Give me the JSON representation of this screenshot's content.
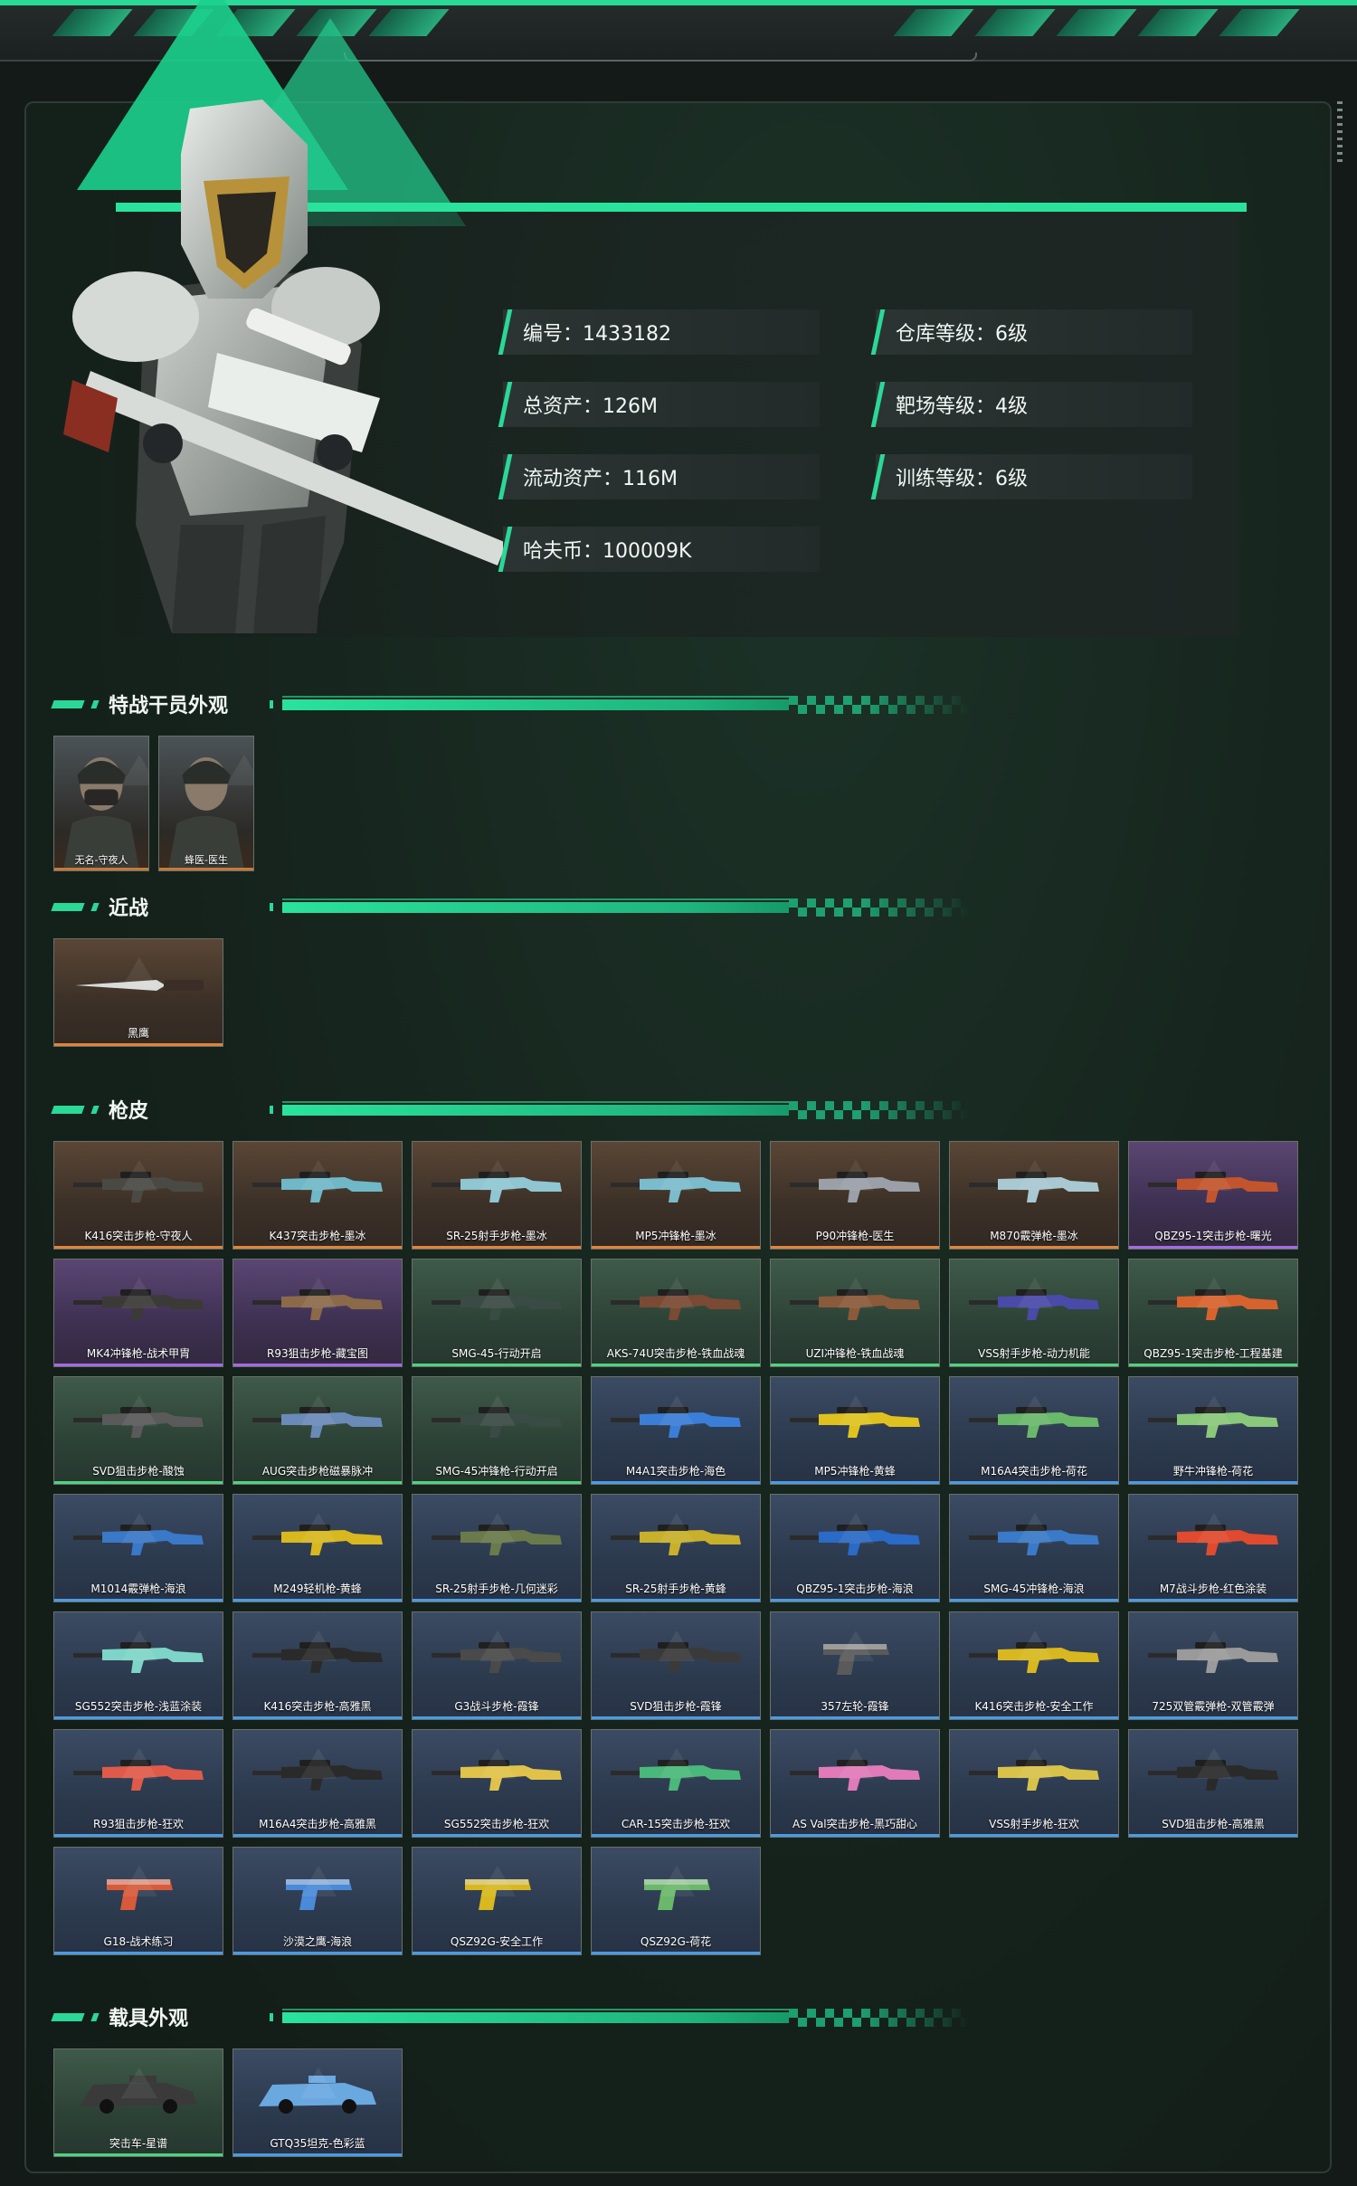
{
  "profile": {
    "info": [
      {
        "label": "编号：1433182"
      },
      {
        "label": "仓库等级：6级"
      },
      {
        "label": "总资产：126M"
      },
      {
        "label": "靶场等级：4级"
      },
      {
        "label": "流动资产：116M"
      },
      {
        "label": "训练等级：6级"
      },
      {
        "label": "哈夫币：100009K"
      }
    ]
  },
  "sections": {
    "operators": {
      "title": "特战干员外观",
      "items": [
        {
          "name": "无名-守夜人",
          "quality": "orange"
        },
        {
          "name": "蜂医-医生",
          "quality": "orange"
        }
      ]
    },
    "melee": {
      "title": "近战",
      "items": [
        {
          "name": "黑鹰",
          "quality": "orange"
        }
      ]
    },
    "skins": {
      "title": "枪皮",
      "items": [
        {
          "name": "K416突击步枪-守夜人",
          "quality": "orange",
          "color": "#4a4a44"
        },
        {
          "name": "K437突击步枪-墨冰",
          "quality": "orange",
          "color": "#6fb8c8"
        },
        {
          "name": "SR-25射手步枪-墨冰",
          "quality": "orange",
          "color": "#8fc6d2"
        },
        {
          "name": "MP5冲锋枪-墨冰",
          "quality": "orange",
          "color": "#7bbccc"
        },
        {
          "name": "P90冲锋枪-医生",
          "quality": "orange",
          "color": "#9a9fa8"
        },
        {
          "name": "M870霰弹枪-墨冰",
          "quality": "orange",
          "color": "#a8c8d2"
        },
        {
          "name": "QBZ95-1突击步枪-曙光",
          "quality": "purple",
          "color": "#c2552e"
        },
        {
          "name": "MK4冲锋枪-战术甲胄",
          "quality": "purple",
          "color": "#3c3a36"
        },
        {
          "name": "R93狙击步枪-藏宝图",
          "quality": "purple",
          "color": "#8b6a4a"
        },
        {
          "name": "SMG-45-行动开启",
          "quality": "green",
          "color": "#3a4a44"
        },
        {
          "name": "AKS-74U突击步枪-铁血战魂",
          "quality": "green",
          "color": "#7a4a34"
        },
        {
          "name": "UZI冲锋枪-铁血战魂",
          "quality": "green",
          "color": "#8a5a3a"
        },
        {
          "name": "VSS射手步枪-动力机能",
          "quality": "green",
          "color": "#4a4aa8"
        },
        {
          "name": "QBZ95-1突击步枪-工程基建",
          "quality": "green",
          "color": "#d8622e"
        },
        {
          "name": "SVD狙击步枪-酸蚀",
          "quality": "green",
          "color": "#5a5a5a"
        },
        {
          "name": "AUG突击步枪磁暴脉冲",
          "quality": "green",
          "color": "#6a8ab8"
        },
        {
          "name": "SMG-45冲锋枪-行动开启",
          "quality": "green",
          "color": "#3a4a44"
        },
        {
          "name": "M4A1突击步枪-海色",
          "quality": "blue",
          "color": "#3a7ed8"
        },
        {
          "name": "MP5冲锋枪-黄蜂",
          "quality": "blue",
          "color": "#e0c21e"
        },
        {
          "name": "M16A4突击步枪-荷花",
          "quality": "blue",
          "color": "#6ab86a"
        },
        {
          "name": "野牛冲锋枪-荷花",
          "quality": "blue",
          "color": "#8ac87a"
        },
        {
          "name": "M1014霰弹枪-海浪",
          "quality": "blue",
          "color": "#3a78c8"
        },
        {
          "name": "M249轻机枪-黄蜂",
          "quality": "blue",
          "color": "#d8b81e"
        },
        {
          "name": "SR-25射手步枪-几何迷彩",
          "quality": "blue",
          "color": "#6a7a4a"
        },
        {
          "name": "SR-25射手步枪-黄蜂",
          "quality": "blue",
          "color": "#c8b02a"
        },
        {
          "name": "QBZ95-1突击步枪-海浪",
          "quality": "blue",
          "color": "#2a6ac8"
        },
        {
          "name": "SMG-45冲锋枪-海浪",
          "quality": "blue",
          "color": "#3a7ac8"
        },
        {
          "name": "M7战斗步枪-红色涂装",
          "quality": "blue",
          "color": "#e04a2e"
        },
        {
          "name": "SG552突击步枪-浅蓝涂装",
          "quality": "blue",
          "color": "#7ed4c8"
        },
        {
          "name": "K416突击步枪-高雅黑",
          "quality": "blue",
          "color": "#2a2a2a"
        },
        {
          "name": "G3战斗步枪-霞锋",
          "quality": "blue",
          "color": "#4a4a4a"
        },
        {
          "name": "SVD狙击步枪-霞锋",
          "quality": "blue",
          "color": "#3a3a3a"
        },
        {
          "name": "357左轮-霞锋",
          "quality": "blue",
          "color": "#5a5a5a"
        },
        {
          "name": "K416突击步枪-安全工作",
          "quality": "blue",
          "color": "#d8b81e"
        },
        {
          "name": "725双管霰弹枪-双管霰弹",
          "quality": "blue",
          "color": "#9a9a9a"
        },
        {
          "name": "R93狙击步枪-狂欢",
          "quality": "blue",
          "color": "#e05a4a"
        },
        {
          "name": "M16A4突击步枪-高雅黑",
          "quality": "blue",
          "color": "#2a2a2a"
        },
        {
          "name": "SG552突击步枪-狂欢",
          "quality": "blue",
          "color": "#e0c24a"
        },
        {
          "name": "CAR-15突击步枪-狂欢",
          "quality": "blue",
          "color": "#4ab87a"
        },
        {
          "name": "AS Val突击步枪-黑巧甜心",
          "quality": "blue",
          "color": "#e07ab8"
        },
        {
          "name": "VSS射手步枪-狂欢",
          "quality": "blue",
          "color": "#d8c24a"
        },
        {
          "name": "SVD狙击步枪-高雅黑",
          "quality": "blue",
          "color": "#2a2a2a"
        },
        {
          "name": "G18-战术练习",
          "quality": "blue",
          "color": "#d85a3a"
        },
        {
          "name": "沙漠之鹰-海浪",
          "quality": "blue",
          "color": "#4a8ad8"
        },
        {
          "name": "QSZ92G-安全工作",
          "quality": "blue",
          "color": "#d8b81e"
        },
        {
          "name": "QSZ92G-荷花",
          "quality": "blue",
          "color": "#6ab86a"
        }
      ]
    },
    "vehicles": {
      "title": "载具外观",
      "items": [
        {
          "name": "突击车-星谱",
          "quality": "green",
          "color": "#3a3a3a"
        },
        {
          "name": "GTQ35坦克-色彩蓝",
          "quality": "blue",
          "color": "#6aa8e0"
        }
      ]
    }
  }
}
